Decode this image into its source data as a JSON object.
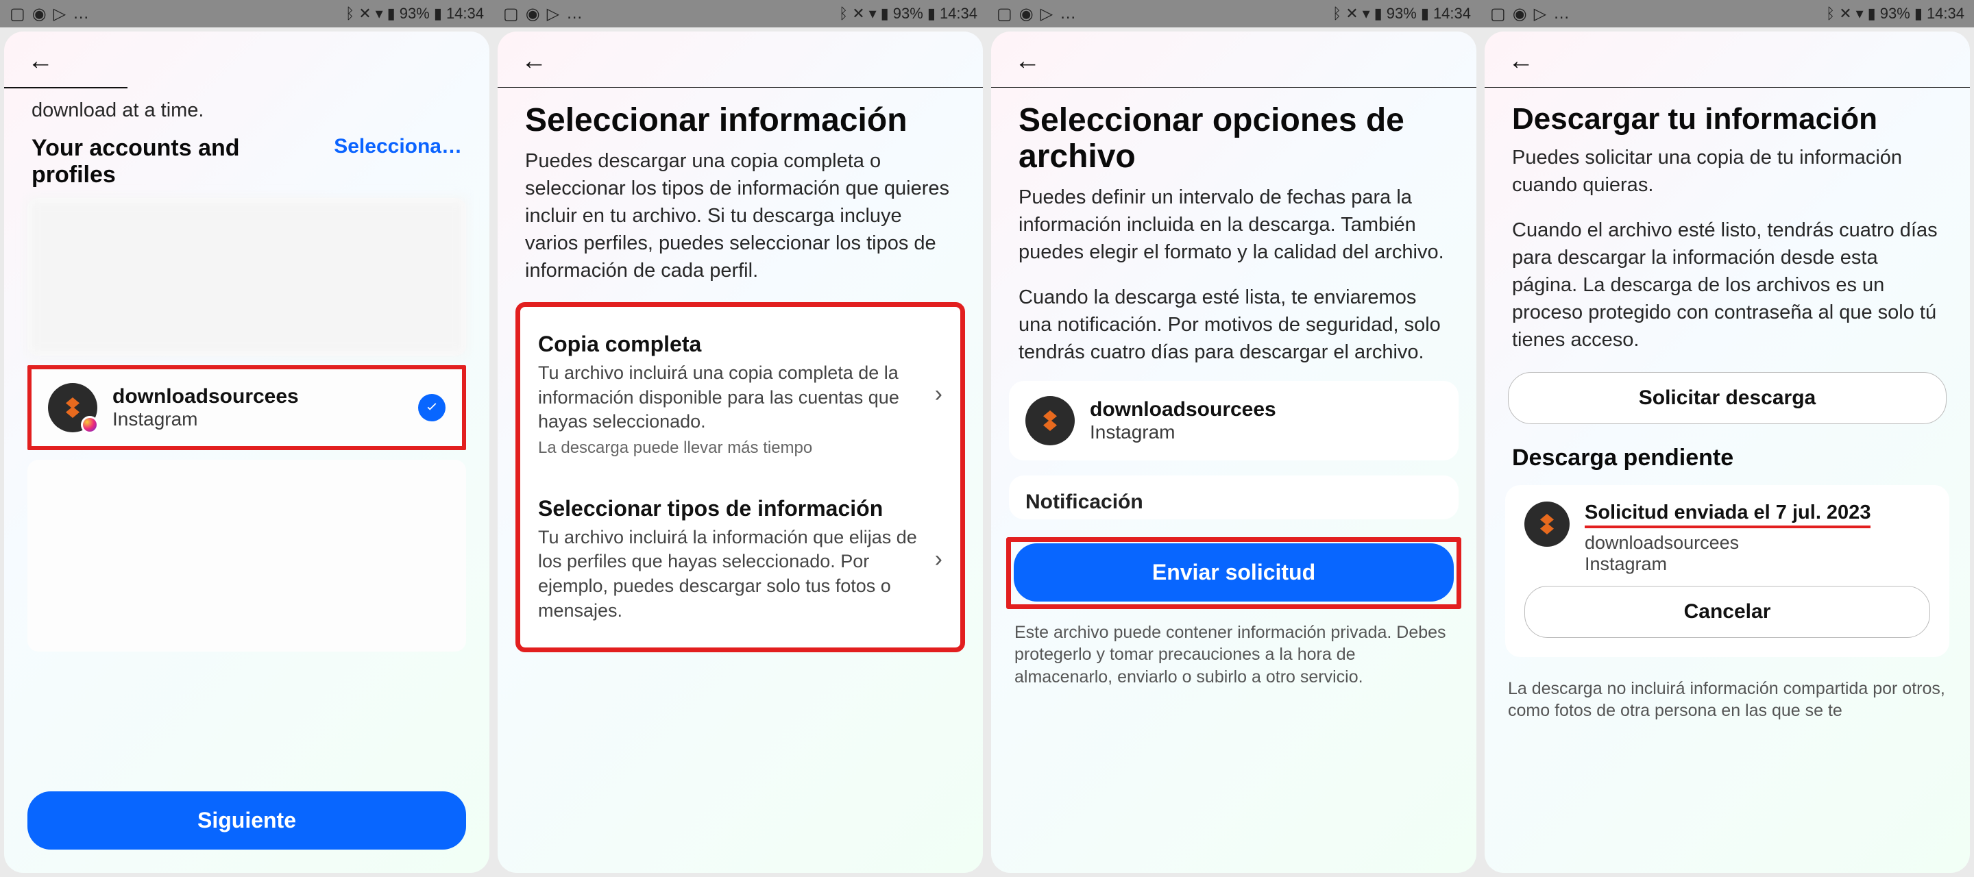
{
  "status_bar": {
    "battery": "93%",
    "time": "14:34"
  },
  "screen1": {
    "top_fragment": "download at a time.",
    "accounts_heading": "Your accounts and profiles",
    "select_link": "Selecciona…",
    "profile_name": "downloadsourcees",
    "profile_platform": "Instagram",
    "next_button": "Siguiente"
  },
  "screen2": {
    "title": "Seleccionar información",
    "intro": "Puedes descargar una copia completa o seleccionar los tipos de información que quieres incluir en tu archivo. Si tu descarga incluye varios perfiles, puedes seleccionar los tipos de información de cada perfil.",
    "option1_title": "Copia completa",
    "option1_desc": "Tu archivo incluirá una copia completa de la información disponible para las cuentas que hayas seleccionado.",
    "option1_note": "La descarga puede llevar más tiempo",
    "option2_title": "Seleccionar tipos de información",
    "option2_desc": "Tu archivo incluirá la información que elijas de los perfiles que hayas seleccionado. Por ejemplo, puedes descargar solo tus fotos o mensajes."
  },
  "screen3": {
    "title": "Seleccionar opciones de archivo",
    "p1": "Puedes definir un intervalo de fechas para la información incluida en la descarga. También puedes elegir el formato y la calidad del archivo.",
    "p2": "Cuando la descarga esté lista, te enviaremos una notificación. Por motivos de seguridad, solo tendrás cuatro días para descargar el archivo.",
    "profile_name": "downloadsourcees",
    "profile_platform": "Instagram",
    "notif_heading": "Notificación",
    "send_button": "Enviar solicitud",
    "footer": "Este archivo puede contener información privada. Debes protegerlo y tomar precauciones a la hora de almacenarlo, enviarlo o subirlo a otro servicio."
  },
  "screen4": {
    "title": "Descargar tu información",
    "p1": "Puedes solicitar una copia de tu información cuando quieras.",
    "p2": "Cuando el archivo esté listo, tendrás cuatro días para descargar la información desde esta página. La descarga de los archivos es un proceso protegido con contraseña al que solo tú tienes acceso.",
    "request_button": "Solicitar descarga",
    "pending_heading": "Descarga pendiente",
    "pending_title": "Solicitud enviada el 7 jul. 2023",
    "pending_name": "downloadsourcees",
    "pending_platform": "Instagram",
    "cancel_button": "Cancelar",
    "footer": "La descarga no incluirá información compartida por otros, como fotos de otra persona en las que se te"
  }
}
